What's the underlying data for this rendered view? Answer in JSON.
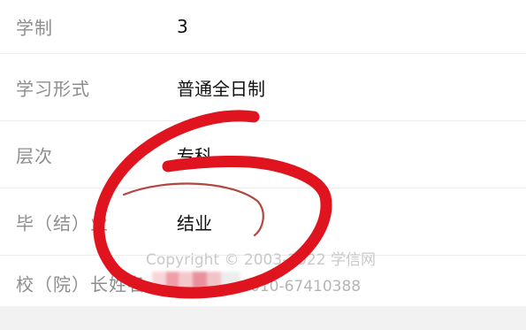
{
  "rows": [
    {
      "label": "学制",
      "value": "3"
    },
    {
      "label": "学习形式",
      "value": "普通全日制"
    },
    {
      "label": "层次",
      "value": "专科"
    },
    {
      "label": "毕（结）业",
      "value": "结业"
    },
    {
      "label": "校（院）长姓名",
      "value": ""
    }
  ],
  "footer": {
    "copyright": "Copyright © 2003-2022 学信网",
    "phone": "010-67410388"
  },
  "annotation": {
    "marker_color": "#e0141e",
    "thin_line_color": "#b3463f"
  }
}
